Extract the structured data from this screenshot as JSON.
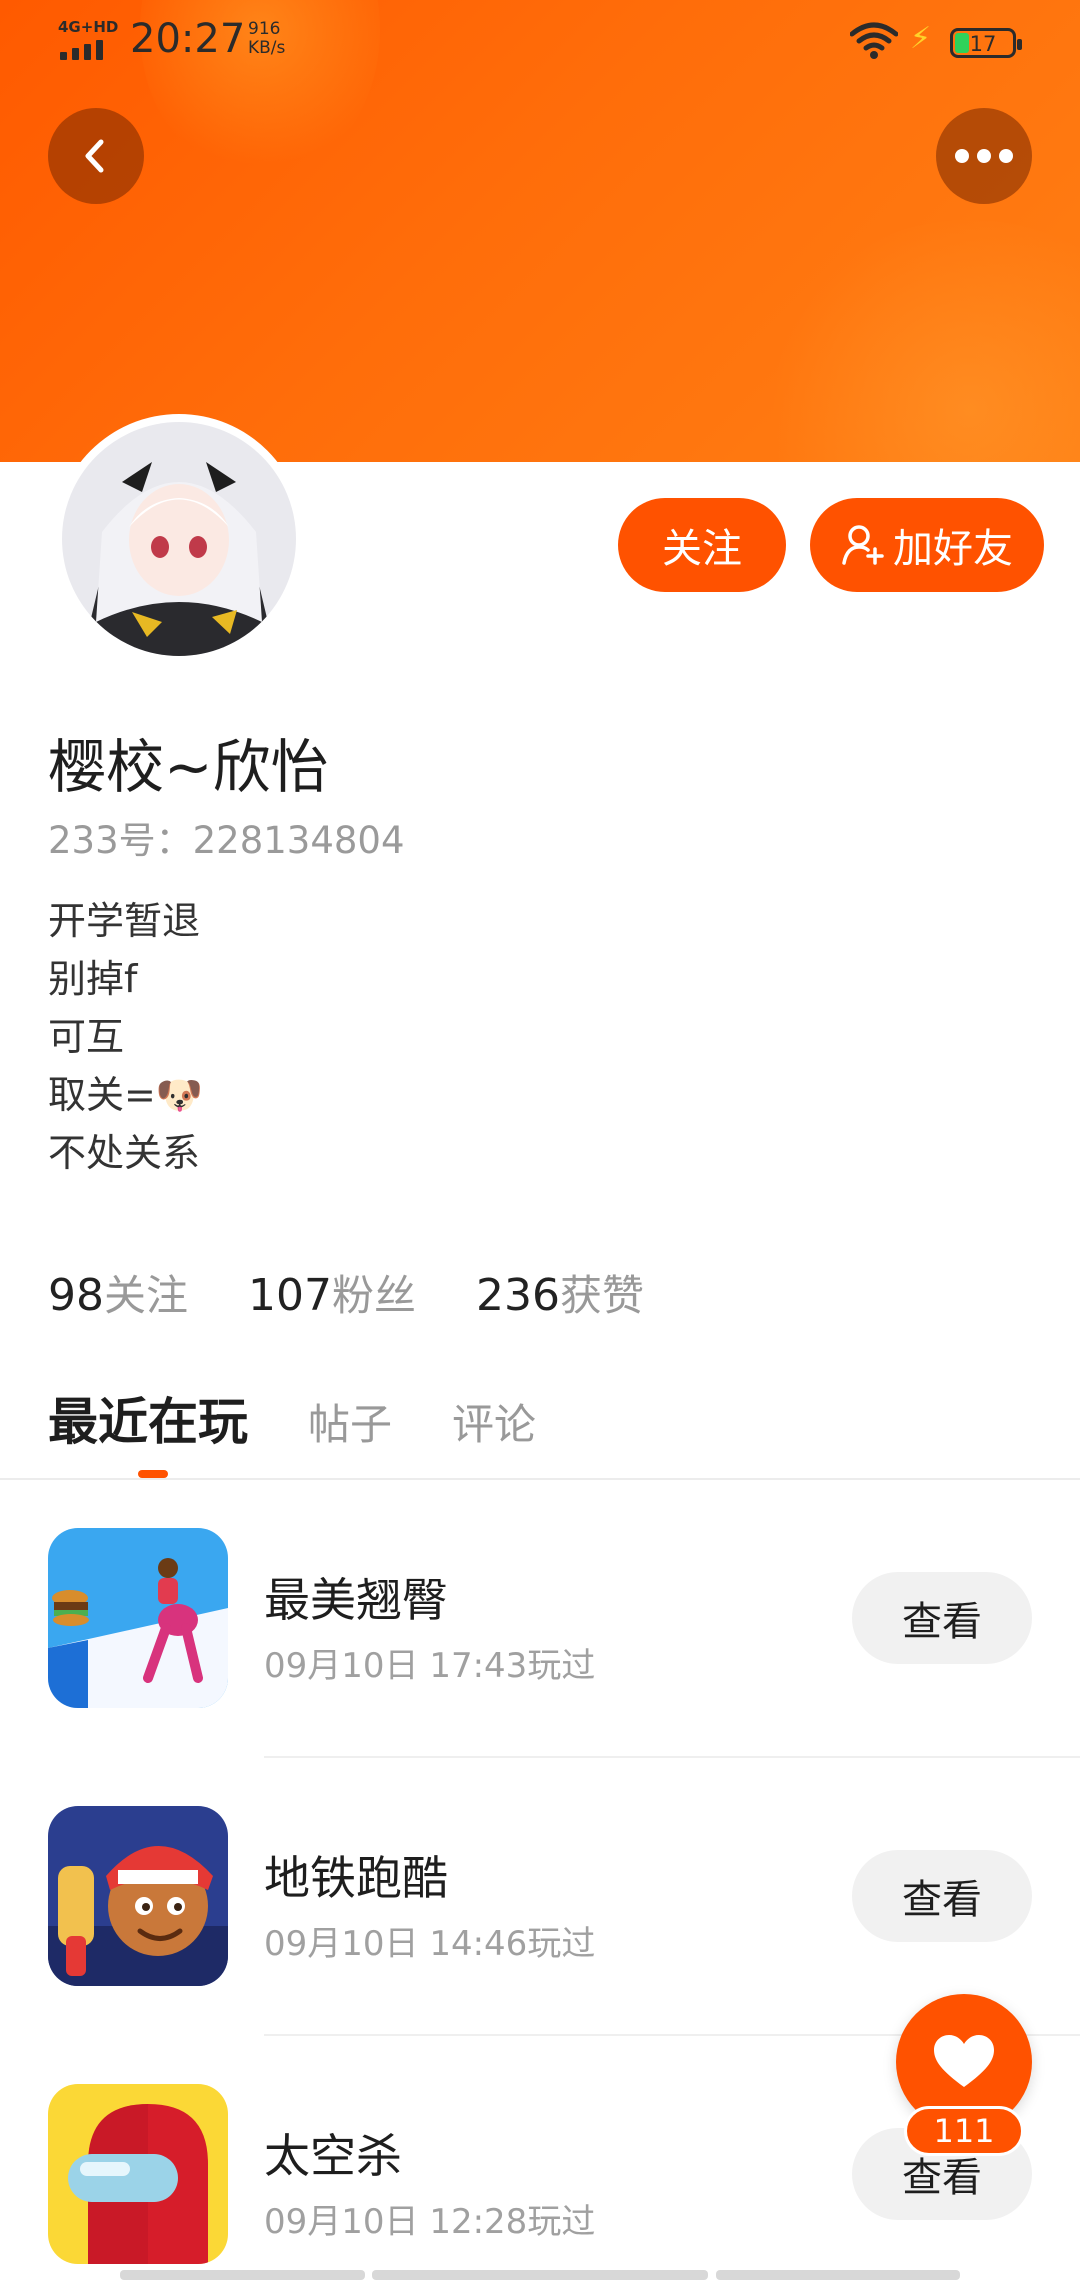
{
  "status_bar": {
    "network": "4G+HD",
    "time": "20:27",
    "speed_value": "916",
    "speed_unit": "KB/s",
    "battery": "17"
  },
  "header": {
    "back_icon": "chevron-left-icon",
    "more_icon": "more-dots-icon"
  },
  "profile": {
    "follow_label": "关注",
    "add_friend_label": "加好友",
    "name": "樱校~欣怡",
    "id_text": "233号：228134804",
    "bio": [
      "开学暂退",
      "别掉f",
      "可互",
      "取关=🐶",
      "不处关系"
    ],
    "stats": [
      {
        "value": "98",
        "label": "关注"
      },
      {
        "value": "107",
        "label": "粉丝"
      },
      {
        "value": "236",
        "label": "获赞"
      }
    ]
  },
  "tabs": [
    {
      "label": "最近在玩",
      "active": true
    },
    {
      "label": "帖子",
      "active": false
    },
    {
      "label": "评论",
      "active": false
    }
  ],
  "games": [
    {
      "name": "最美翘臀",
      "time": "09月10日 17:43玩过",
      "action": "查看"
    },
    {
      "name": "地铁跑酷",
      "time": "09月10日 14:46玩过",
      "action": "查看"
    },
    {
      "name": "太空杀",
      "time": "09月10日 12:28玩过",
      "action": "查看"
    }
  ],
  "like_fab": {
    "icon": "heart-icon",
    "count": "111"
  },
  "colors": {
    "accent": "#ff5200",
    "banner": "#ff6d0a"
  }
}
